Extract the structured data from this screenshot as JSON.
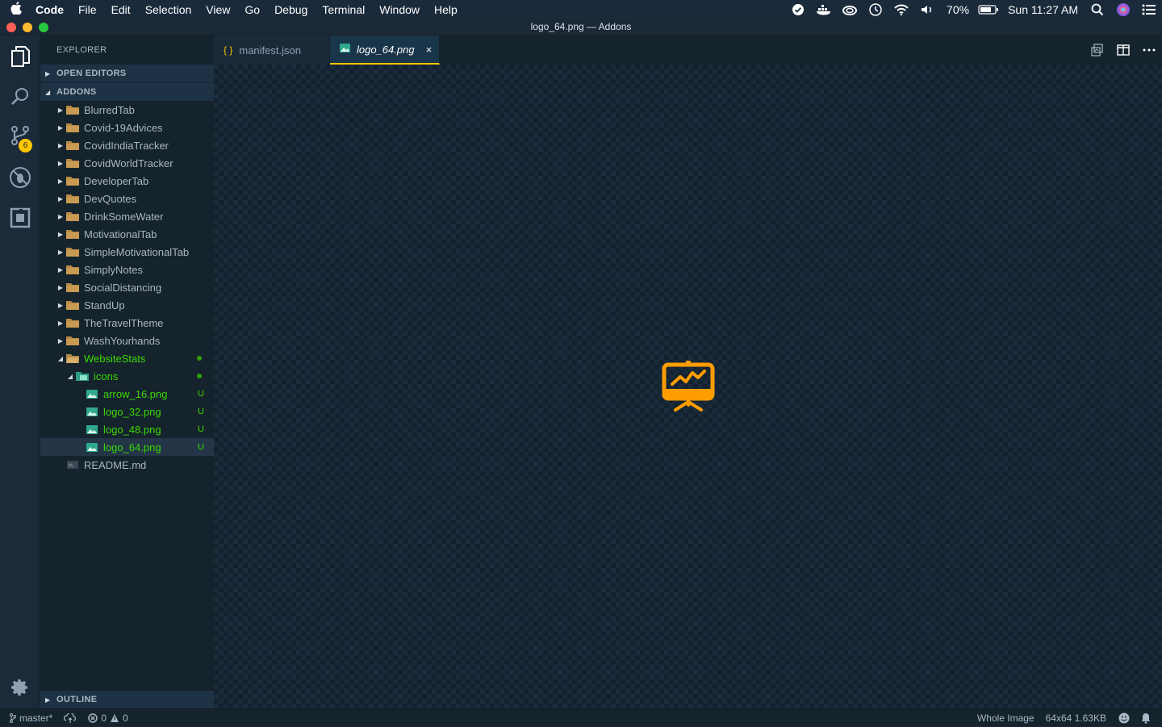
{
  "menubar": {
    "app": "Code",
    "items": [
      "File",
      "Edit",
      "Selection",
      "View",
      "Go",
      "Debug",
      "Terminal",
      "Window",
      "Help"
    ],
    "battery": "70%",
    "clock": "Sun 11:27 AM",
    "status_icons": [
      "checkmark-app-icon",
      "docker-icon",
      "creative-cloud-icon",
      "time-machine-icon",
      "wifi-icon",
      "volume-icon",
      "battery-icon",
      "spotlight-search-icon",
      "siri-icon",
      "notification-center-icon"
    ]
  },
  "window": {
    "title": "logo_64.png — Addons"
  },
  "activitybar": {
    "icons": [
      "explorer-icon",
      "search-icon",
      "source-control-icon",
      "debug-icon",
      "extensions-icon",
      "settings-gear-icon"
    ],
    "scm_badge": "6"
  },
  "sidebar": {
    "title": "EXPLORER",
    "open_editors": "OPEN EDITORS",
    "workspace": "ADDONS",
    "folders": [
      "BlurredTab",
      "Covid-19Advices",
      "CovidIndiaTracker",
      "CovidWorldTracker",
      "DeveloperTab",
      "DevQuotes",
      "DrinkSomeWater",
      "MotivationalTab",
      "SimpleMotivationalTab",
      "SimplyNotes",
      "SocialDistancing",
      "StandUp",
      "TheTravelTheme",
      "WashYourhands"
    ],
    "expanded_folder": "WebsiteStats",
    "subfolder": "icons",
    "files": [
      {
        "name": "arrow_16.png",
        "status": "U"
      },
      {
        "name": "logo_32.png",
        "status": "U"
      },
      {
        "name": "logo_48.png",
        "status": "U"
      },
      {
        "name": "logo_64.png",
        "status": "U"
      }
    ],
    "readme": "README.md",
    "outline": "OUTLINE"
  },
  "tabs": [
    {
      "label": "manifest.json",
      "icon": "{ }"
    },
    {
      "label": "logo_64.png",
      "icon": "image-icon",
      "close": "×"
    }
  ],
  "statusbar": {
    "branch": "master*",
    "errors": "0",
    "warnings": "0",
    "whole_image": "Whole Image",
    "image_info": "64x64 1.63KB"
  },
  "colors": {
    "accent": "#ffc600",
    "git_untracked": "#3ad900",
    "logo": "#ff9d00"
  }
}
